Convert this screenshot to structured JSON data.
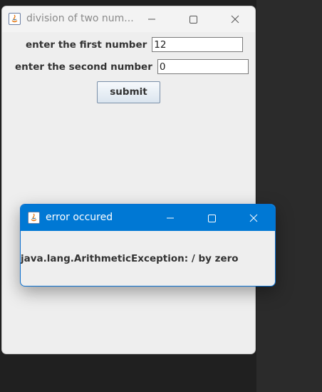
{
  "main_window": {
    "title": "division of two num...",
    "first_label": "enter the first number",
    "first_value": "12",
    "second_label": "enter the second number",
    "second_value": "0",
    "submit_label": "submit"
  },
  "dialog": {
    "title": "error occured",
    "message": "java.lang.ArithmeticException: / by zero"
  },
  "colors": {
    "dialog_titlebar": "#0078d4",
    "window_bg": "#eeeeee",
    "desktop_bg": "#202020"
  },
  "icons": [
    "java-app-icon",
    "minimize-icon",
    "maximize-icon",
    "close-icon"
  ]
}
